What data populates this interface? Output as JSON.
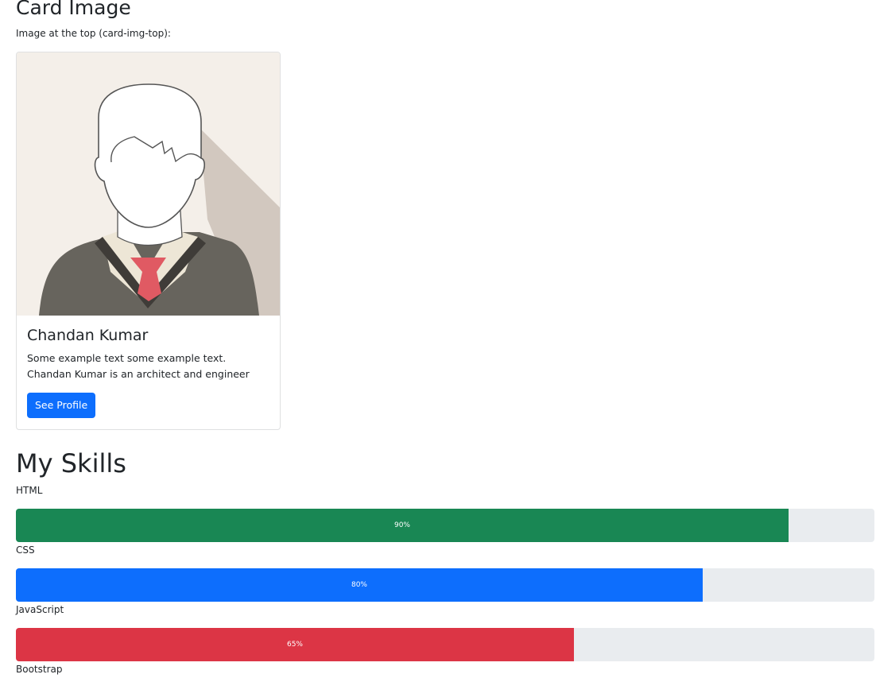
{
  "card_section": {
    "heading": "Card Image",
    "subtext": "Image at the top (card-img-top):",
    "card": {
      "image_icon": "male-avatar-illustration",
      "title": "Chandan Kumar",
      "text": "Some example text some example text. Chandan Kumar is an architect and engineer",
      "button_label": "See Profile",
      "button_color": "#0d6efd"
    }
  },
  "skills_section": {
    "heading": "My Skills",
    "skills": [
      {
        "name": "HTML",
        "percent": 90,
        "label": "90%",
        "color": "#198754"
      },
      {
        "name": "CSS",
        "percent": 80,
        "label": "80%",
        "color": "#0d6efd"
      },
      {
        "name": "JavaScript",
        "percent": 65,
        "label": "65%",
        "color": "#dc3545"
      },
      {
        "name": "Bootstrap"
      }
    ]
  }
}
